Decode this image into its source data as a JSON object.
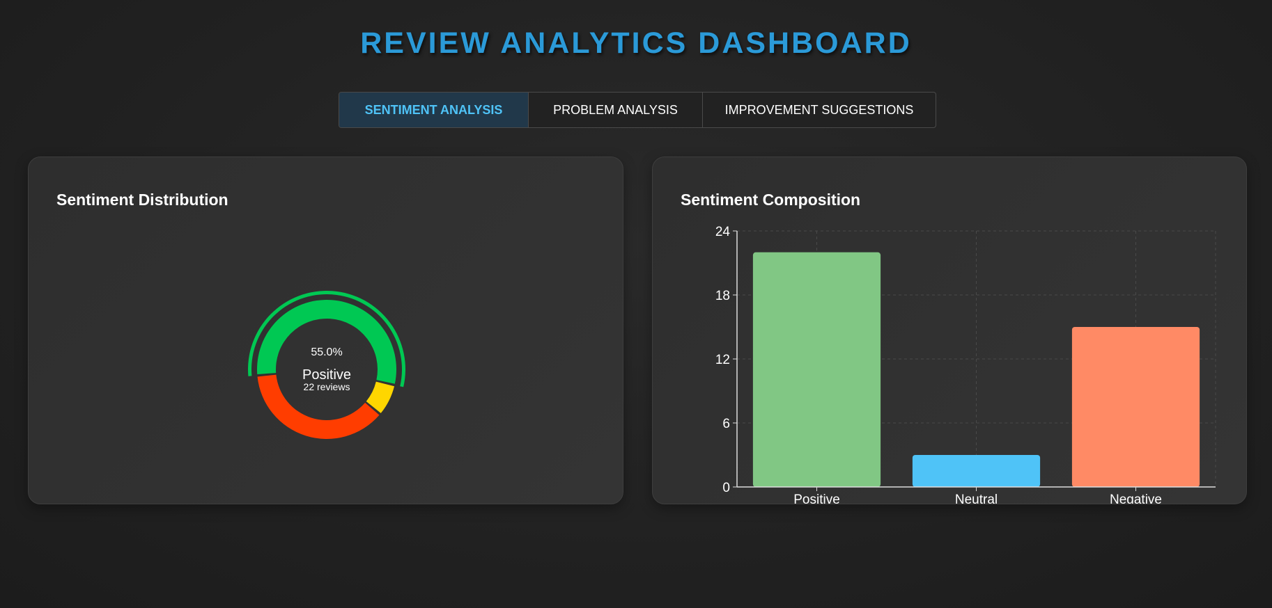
{
  "header": {
    "title": "REVIEW ANALYTICS DASHBOARD"
  },
  "tabs": [
    {
      "label": "SENTIMENT ANALYSIS",
      "active": true
    },
    {
      "label": "PROBLEM ANALYSIS",
      "active": false
    },
    {
      "label": "IMPROVEMENT SUGGESTIONS",
      "active": false
    }
  ],
  "distribution_card": {
    "title": "Sentiment Distribution",
    "center_percent": "55.0%",
    "center_label": "Positive",
    "center_count": "22 reviews"
  },
  "composition_card": {
    "title": "Sentiment Composition"
  },
  "colors": {
    "accent": "#2b9ad8",
    "donut_positive": "#00c853",
    "donut_neutral": "#ffd600",
    "donut_negative": "#ff3d00",
    "bar_positive": "#81c784",
    "bar_neutral": "#4fc3f7",
    "bar_negative": "#ff8a65"
  },
  "chart_data": [
    {
      "type": "pie",
      "variant": "donut",
      "categories": [
        "Positive",
        "Neutral",
        "Negative"
      ],
      "values": [
        22,
        3,
        15
      ],
      "highlighted": "Positive"
    },
    {
      "type": "bar",
      "categories": [
        "Positive",
        "Neutral",
        "Negative"
      ],
      "values": [
        22,
        3,
        15
      ],
      "ylim": [
        0,
        24
      ],
      "yticks": [
        0,
        6,
        12,
        18,
        24
      ],
      "grid": true
    }
  ]
}
